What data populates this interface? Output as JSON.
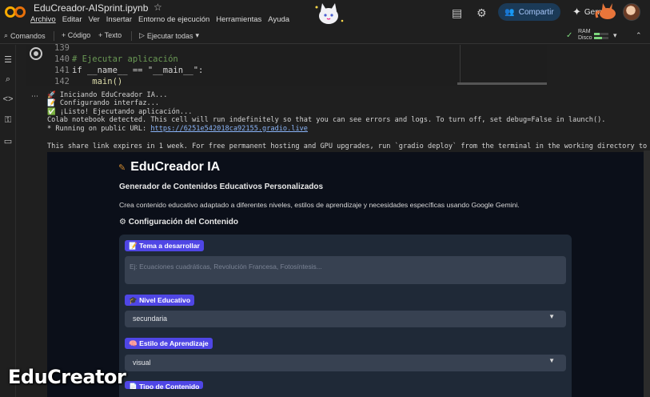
{
  "header": {
    "filename": "EduCreador-AISprint.ipynb",
    "menu": [
      "Archivo",
      "Editar",
      "Ver",
      "Insertar",
      "Entorno de ejecución",
      "Herramientas",
      "Ayuda"
    ],
    "share_label": "Compartir",
    "gemini_label": "Gemini"
  },
  "toolbar": {
    "commands": "Comandos",
    "add_code": "+ Código",
    "add_text": "+ Texto",
    "run_all": "Ejecutar todas",
    "ram_label": "RAM",
    "disk_label": "Disco"
  },
  "code": {
    "lines": [
      {
        "n": "139",
        "text": ""
      },
      {
        "n": "140",
        "text": "# Ejecutar aplicación"
      },
      {
        "n": "141",
        "text": "if __name__ == \"__main__\":"
      },
      {
        "n": "142",
        "text": "    main()"
      }
    ]
  },
  "output": {
    "lines": [
      "🚀 Iniciando EduCreador IA...",
      "📝 Configurando interfaz...",
      "✅ ¡Listo! Ejecutando aplicación...",
      "Colab notebook detected. This cell will run indefinitely so that you can see errors and logs. To turn off, set debug=False in launch().",
      "* Running on public URL: "
    ],
    "public_url": "https://6251e542018ca92155.gradio.live",
    "share_line": "This share link expires in 1 week. For free permanent hosting and GPU upgrades, run `gradio deploy` from the terminal in the working directory to deplo"
  },
  "app": {
    "title": "EduCreador IA",
    "subtitle": "Generador de Contenidos Educativos Personalizados",
    "description": "Crea contenido educativo adaptado a diferentes niveles, estilos de aprendizaje y necesidades específicas usando Google Gemini.",
    "config_heading": "⚙ Configuración del Contenido",
    "topic_label": "📝 Tema a desarrollar",
    "topic_placeholder": "Ej: Ecuaciones cuadráticas, Revolución Francesa, Fotosíntesis...",
    "level_label": "🎓 Nivel Educativo",
    "level_value": "secundaria",
    "style_label": "🧠 Estilo de Aprendizaje",
    "style_value": "visual",
    "type_label": "📄 Tipo de Contenido"
  },
  "watermark": "EduCreator",
  "colors": {
    "accent": "#4f46e5",
    "link": "#8ab4f8",
    "panel": "#1f2937"
  }
}
